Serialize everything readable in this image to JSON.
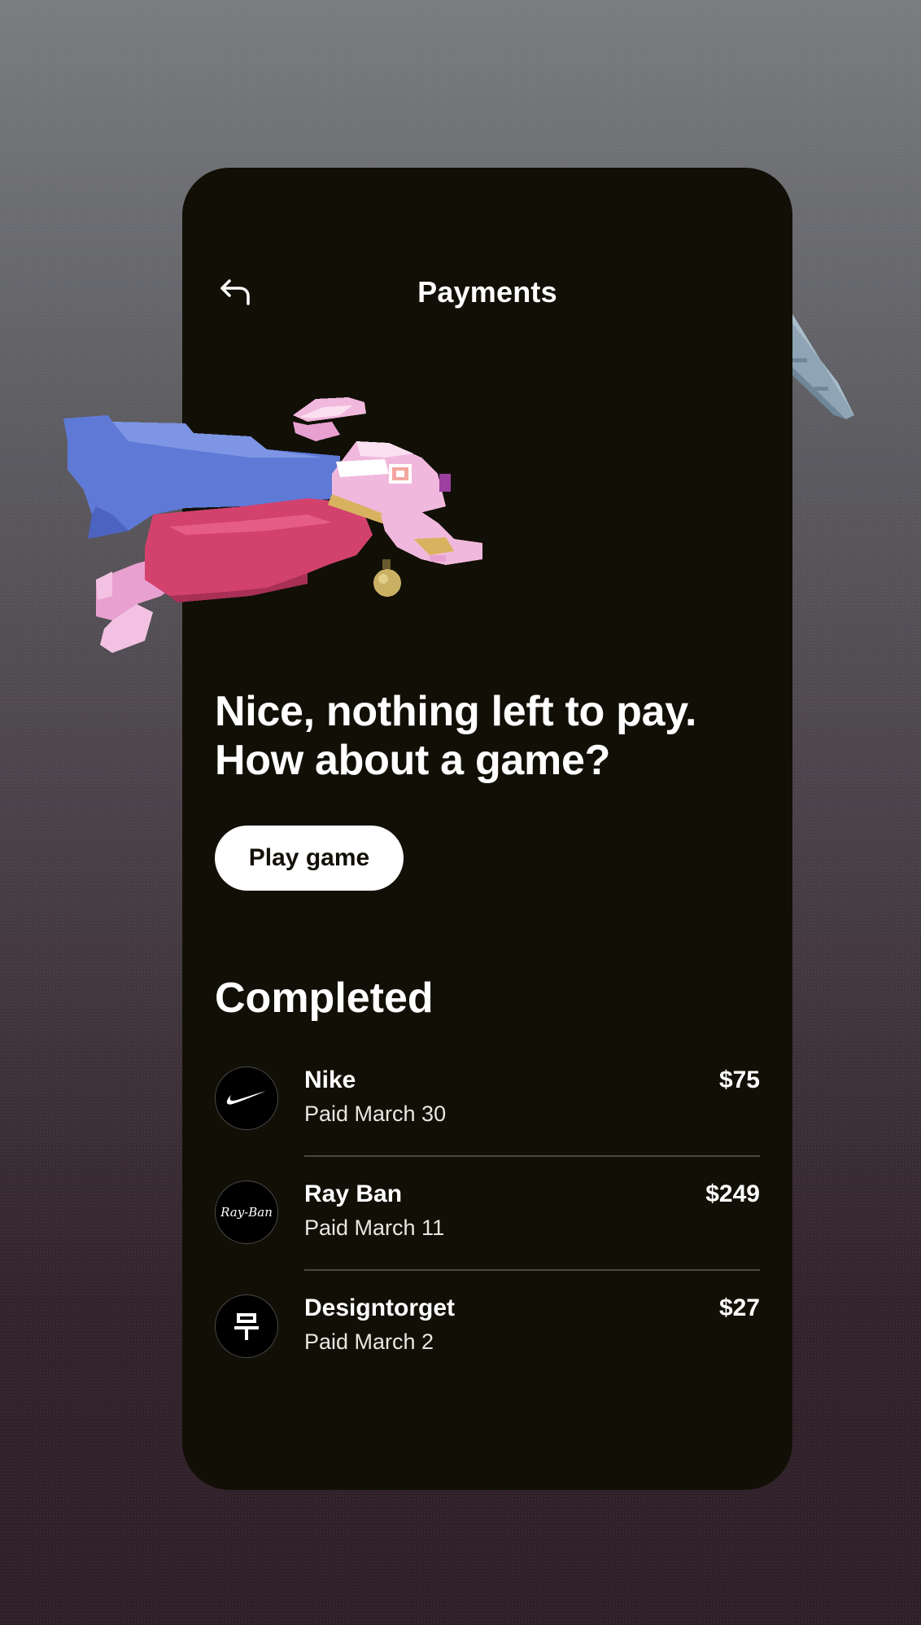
{
  "header": {
    "title": "Payments",
    "back_icon": "back-arrow-icon"
  },
  "hero": {
    "line1": "Nice, nothing left to pay.",
    "line2": "How about a game?",
    "play_label": "Play game",
    "illustrations": [
      "flying-rabbit-illustration",
      "carrot-illustration"
    ]
  },
  "completed": {
    "title": "Completed",
    "items": [
      {
        "name": "Nike",
        "date": "Paid March 30",
        "amount": "$75",
        "logo": "nike-logo-icon"
      },
      {
        "name": "Ray Ban",
        "date": "Paid March 11",
        "amount": "$249",
        "logo": "rayban-logo-icon",
        "logo_text": "Ray-Ban"
      },
      {
        "name": "Designtorget",
        "date": "Paid March 2",
        "amount": "$27",
        "logo": "designtorget-logo-icon"
      }
    ]
  },
  "colors": {
    "card_background": "#121006",
    "text": "#ffffff",
    "button_background": "#ffffff",
    "button_text": "#121006"
  }
}
